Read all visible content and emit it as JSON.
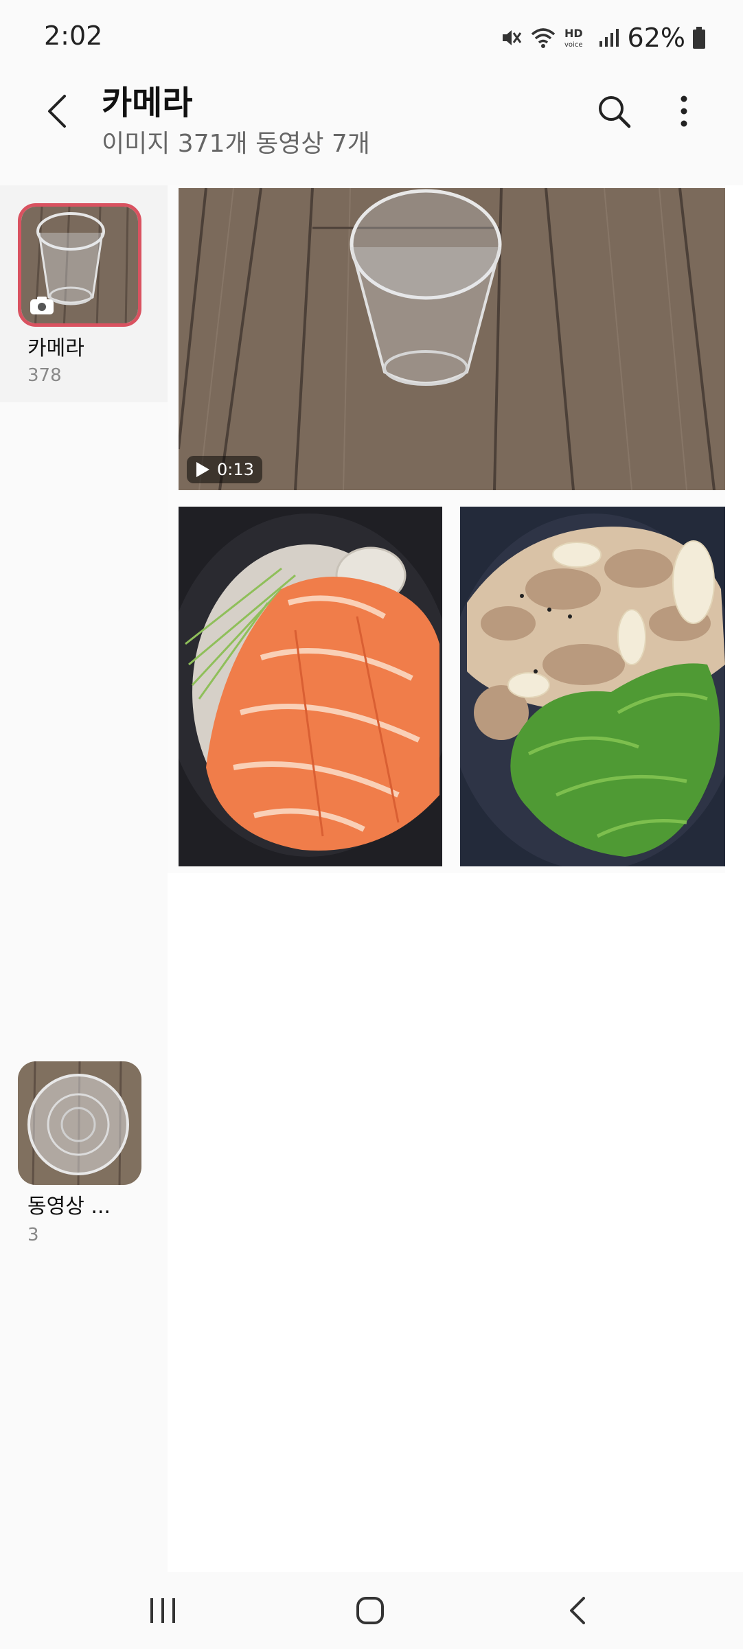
{
  "status_bar": {
    "time": "2:02",
    "battery_percent": "62%",
    "icons": [
      "mute-vibrate-icon",
      "wifi-icon",
      "hd-voice-icon",
      "signal-icon",
      "battery-icon"
    ]
  },
  "header": {
    "title": "카메라",
    "subtitle": "이미지 371개 동영상 7개",
    "back_icon": "back-arrow-icon",
    "search_icon": "search-icon",
    "more_icon": "more-vertical-icon"
  },
  "albums": [
    {
      "name": "카메라",
      "count": "378",
      "selected": true,
      "badge_icon": "camera-icon"
    },
    {
      "name": "동영상 ...",
      "count": "3",
      "selected": false
    }
  ],
  "grid": {
    "items": [
      {
        "type": "video",
        "duration": "0:13",
        "subject": "plastic-cup-on-wood"
      },
      {
        "type": "image",
        "subject": "salmon-sashimi"
      },
      {
        "type": "image",
        "subject": "stir-fried-pork-with-lettuce"
      }
    ]
  },
  "nav_bar": {
    "buttons": [
      "recents-icon",
      "home-icon",
      "back-icon"
    ]
  },
  "colors": {
    "accent_border": "#d95260",
    "background": "#fafafa"
  }
}
